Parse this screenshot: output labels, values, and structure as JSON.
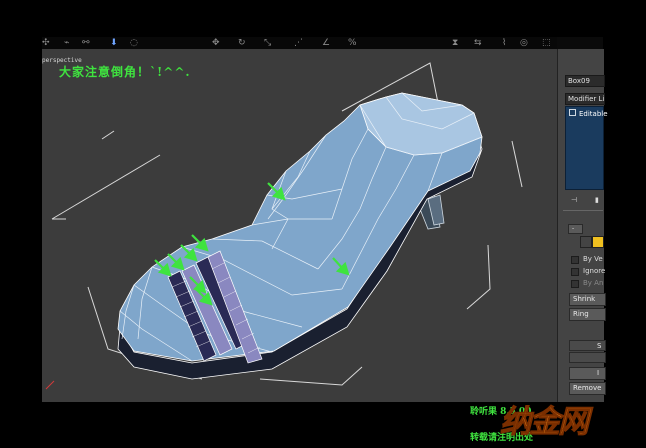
{
  "viewport": {
    "label": "perspective",
    "note": "大家注意倒角！`!^^."
  },
  "panel": {
    "object_name": "Box09",
    "modifier_list": "Modifier List",
    "stack_item": "Editable",
    "by_vertex": "By Ve",
    "ignore": "Ignore",
    "by_angle": "By An",
    "shrink": "Shrink",
    "ring": "Ring",
    "rollout": "S",
    "insert": "I",
    "remove": "Remove"
  },
  "watermark": {
    "line1": "聆听果  8.5.00",
    "line2": "转载请注明出处",
    "logo": "纳金网"
  },
  "colors": {
    "viewport_bg": "#3c3c3c",
    "shoe_fill": "#7fa6cb",
    "annotation_green": "#3fe33f",
    "logo_orange": "#f08a1a"
  }
}
